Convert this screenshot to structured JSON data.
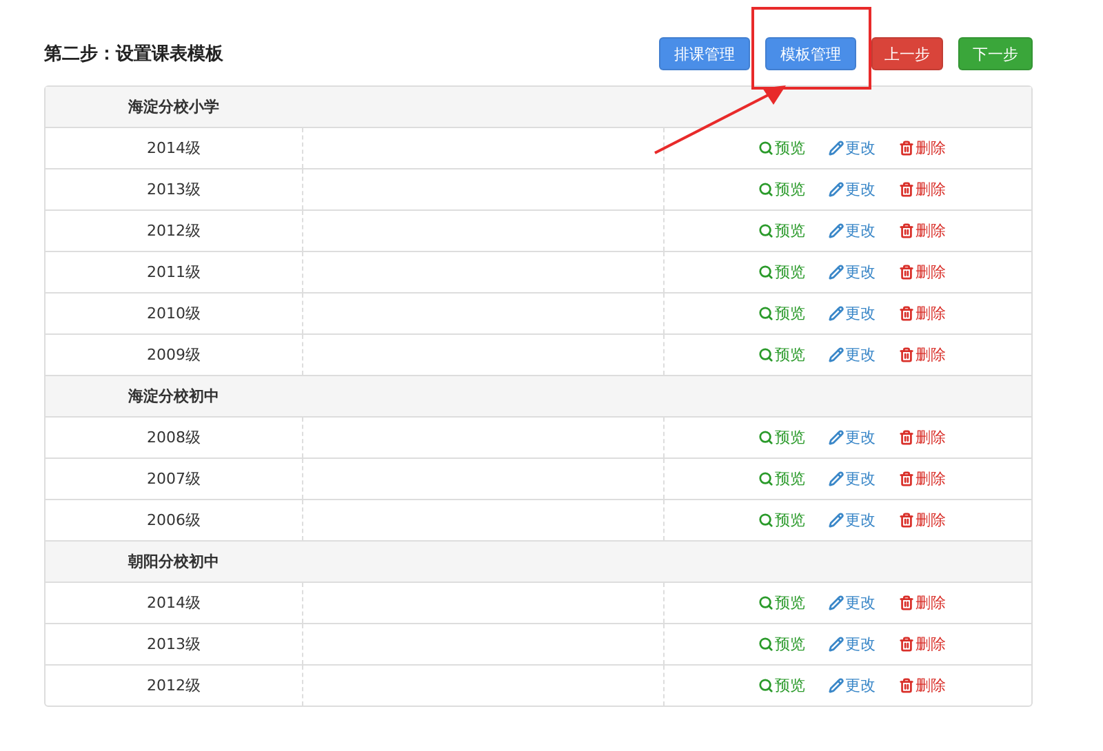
{
  "title": "第二步：设置课表模板",
  "buttons": [
    {
      "label": "排课管理",
      "kind": "primary",
      "highlighted": false
    },
    {
      "label": "模板管理",
      "kind": "primary",
      "highlighted": true
    },
    {
      "label": "上一步",
      "kind": "danger",
      "highlighted": false
    },
    {
      "label": "下一步",
      "kind": "success",
      "highlighted": false
    }
  ],
  "groups": [
    {
      "name": "海淀分校小学",
      "rows": [
        {
          "grade": "2014级",
          "actions": [
            {
              "label": "预览",
              "kind": "preview"
            },
            {
              "label": "更改",
              "kind": "edit"
            },
            {
              "label": "删除",
              "kind": "delete"
            }
          ]
        },
        {
          "grade": "2013级",
          "actions": [
            {
              "label": "预览",
              "kind": "preview"
            },
            {
              "label": "更改",
              "kind": "edit"
            },
            {
              "label": "删除",
              "kind": "delete"
            }
          ]
        },
        {
          "grade": "2012级",
          "actions": [
            {
              "label": "预览",
              "kind": "preview"
            },
            {
              "label": "更改",
              "kind": "edit"
            },
            {
              "label": "删除",
              "kind": "delete"
            }
          ]
        },
        {
          "grade": "2011级",
          "actions": [
            {
              "label": "预览",
              "kind": "preview"
            },
            {
              "label": "更改",
              "kind": "edit"
            },
            {
              "label": "删除",
              "kind": "delete"
            }
          ]
        },
        {
          "grade": "2010级",
          "actions": [
            {
              "label": "预览",
              "kind": "preview"
            },
            {
              "label": "更改",
              "kind": "edit"
            },
            {
              "label": "删除",
              "kind": "delete"
            }
          ]
        },
        {
          "grade": "2009级",
          "actions": [
            {
              "label": "预览",
              "kind": "preview"
            },
            {
              "label": "更改",
              "kind": "edit"
            },
            {
              "label": "删除",
              "kind": "delete"
            }
          ]
        }
      ]
    },
    {
      "name": "海淀分校初中",
      "rows": [
        {
          "grade": "2008级",
          "actions": [
            {
              "label": "预览",
              "kind": "preview"
            },
            {
              "label": "更改",
              "kind": "edit"
            },
            {
              "label": "删除",
              "kind": "delete"
            }
          ]
        },
        {
          "grade": "2007级",
          "actions": [
            {
              "label": "预览",
              "kind": "preview"
            },
            {
              "label": "更改",
              "kind": "edit"
            },
            {
              "label": "删除",
              "kind": "delete"
            }
          ]
        },
        {
          "grade": "2006级",
          "actions": [
            {
              "label": "预览",
              "kind": "preview"
            },
            {
              "label": "更改",
              "kind": "edit"
            },
            {
              "label": "删除",
              "kind": "delete"
            }
          ]
        }
      ]
    },
    {
      "name": "朝阳分校初中",
      "rows": [
        {
          "grade": "2014级",
          "actions": [
            {
              "label": "预览",
              "kind": "preview"
            },
            {
              "label": "更改",
              "kind": "edit"
            },
            {
              "label": "删除",
              "kind": "delete"
            }
          ]
        },
        {
          "grade": "2013级",
          "actions": [
            {
              "label": "预览",
              "kind": "preview"
            },
            {
              "label": "更改",
              "kind": "edit"
            },
            {
              "label": "删除",
              "kind": "delete"
            }
          ]
        },
        {
          "grade": "2012级",
          "actions": [
            {
              "label": "预览",
              "kind": "preview"
            },
            {
              "label": "更改",
              "kind": "edit"
            },
            {
              "label": "删除",
              "kind": "delete"
            }
          ]
        }
      ]
    }
  ]
}
